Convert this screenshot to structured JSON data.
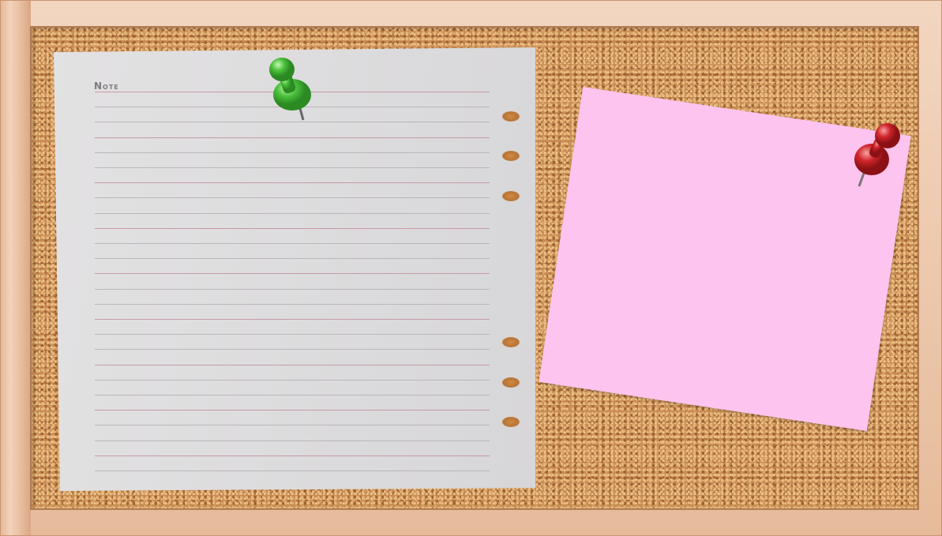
{
  "board": {
    "frame_color": "#e9c2a3",
    "cork_color": "#c98e55"
  },
  "notepaper": {
    "label": "Note",
    "color": "#dcdbdd",
    "line_count": 26
  },
  "sticky_note": {
    "color": "#fdc4ef"
  },
  "pins": [
    {
      "name": "green-pushpin-icon",
      "color": "#4cc23d"
    },
    {
      "name": "red-pushpin-icon",
      "color": "#d0262b"
    }
  ]
}
